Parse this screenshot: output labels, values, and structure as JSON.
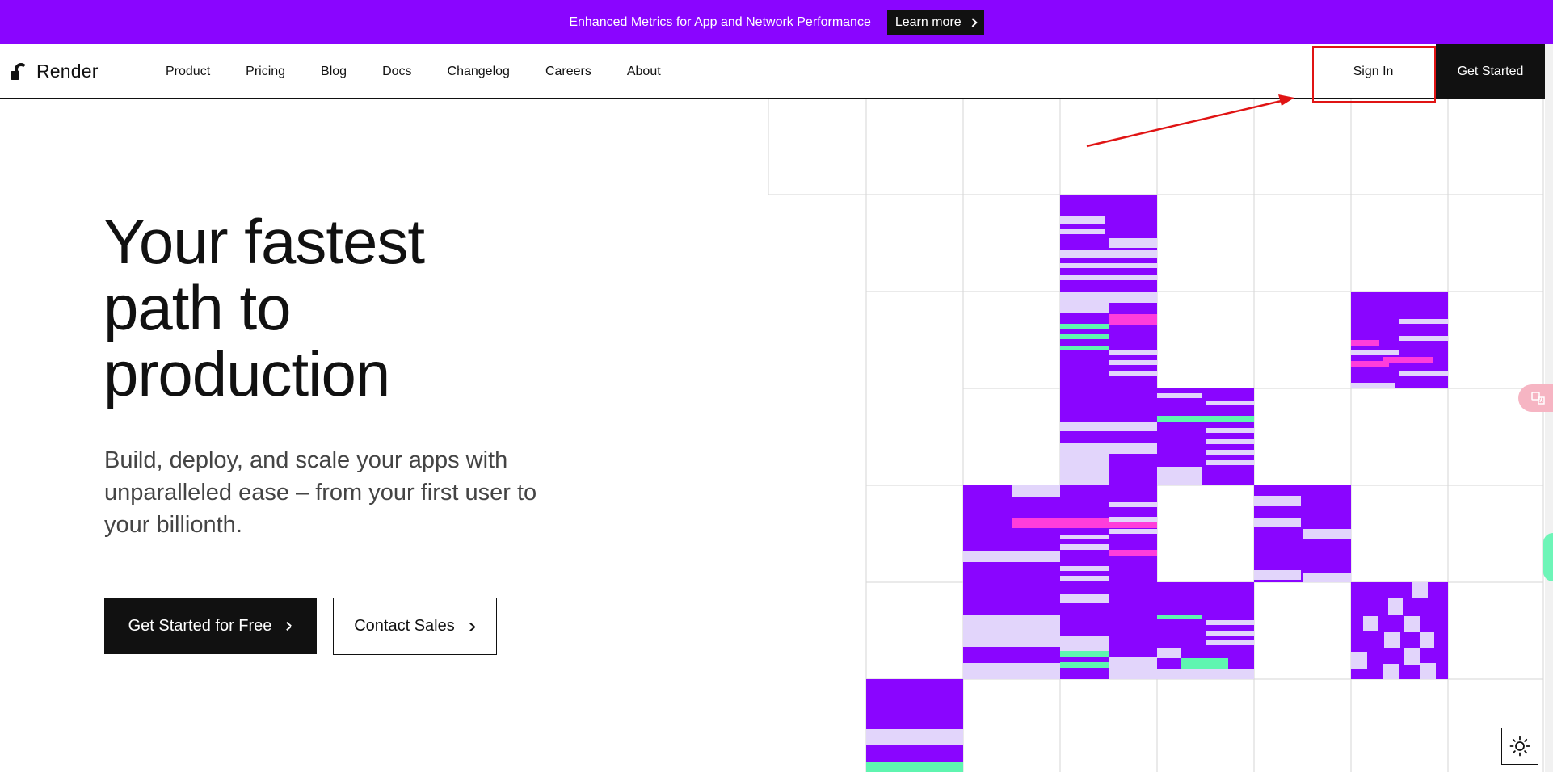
{
  "banner": {
    "text": "Enhanced Metrics for App and Network Performance",
    "button_label": "Learn more",
    "background": "#8a05ff"
  },
  "nav": {
    "brand": "Render",
    "links": [
      "Product",
      "Pricing",
      "Blog",
      "Docs",
      "Changelog",
      "Careers",
      "About"
    ],
    "sign_in": "Sign In",
    "get_started": "Get Started"
  },
  "hero": {
    "title_lines": [
      "Your fastest",
      "path to",
      "production"
    ],
    "subtitle": "Build, deploy, and scale your apps with unparalleled ease – from your first user to your billionth.",
    "primary_cta": "Get Started for Free",
    "secondary_cta": "Contact Sales"
  },
  "widgets": {
    "translate_icon": "translate-icon",
    "theme_icon": "sun-icon"
  },
  "colors": {
    "accent_purple": "#8a05ff",
    "light_lavender": "#e2d5fb",
    "mint": "#5ff5b0",
    "magenta": "#ff3ddb",
    "annotation_red": "#e01414"
  }
}
